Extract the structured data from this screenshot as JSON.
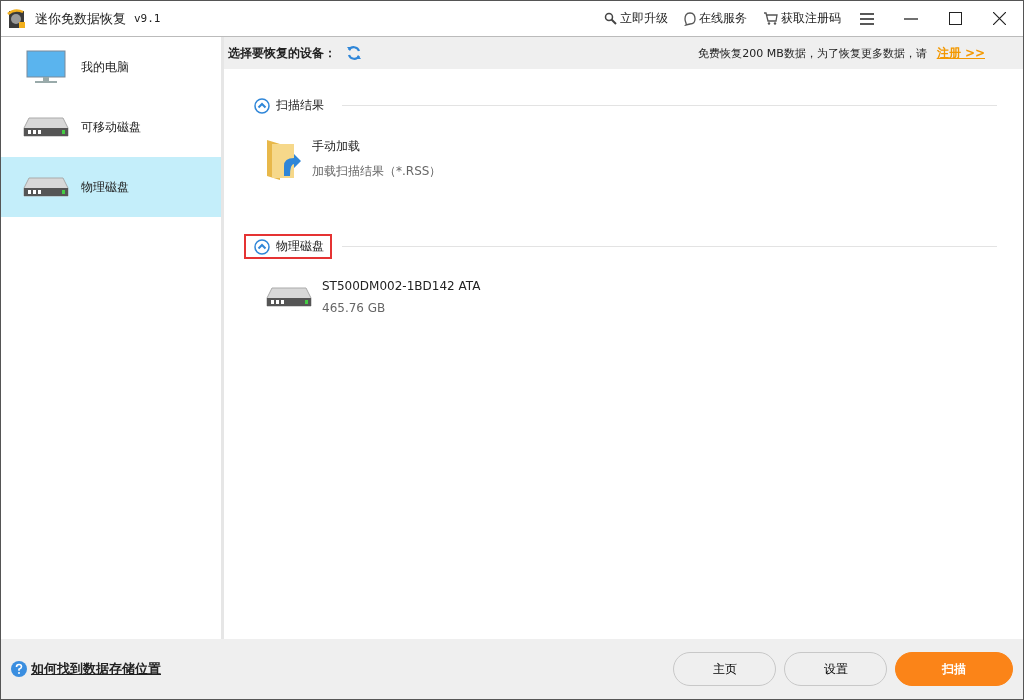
{
  "window": {
    "title": "迷你免数据恢复",
    "version": "v9.1"
  },
  "title_links": [
    {
      "kind": "upgrade",
      "label": "立即升级"
    },
    {
      "kind": "service",
      "label": "在线服务"
    },
    {
      "kind": "register",
      "label": "获取注册码"
    }
  ],
  "sidebar": {
    "items": [
      {
        "kind": "computer",
        "label": "我的电脑",
        "selected": false
      },
      {
        "kind": "removable",
        "label": "可移动磁盘",
        "selected": false
      },
      {
        "kind": "physical",
        "label": "物理磁盘",
        "selected": true
      }
    ]
  },
  "toolbar": {
    "label": "选择要恢复的设备：",
    "notice": "免费恢复200 MB数据，为了恢复更多数据，请",
    "register_link": "注册 >>"
  },
  "sections": [
    {
      "title": "扫描结果",
      "expanded": true,
      "highlighted": false,
      "items": [
        {
          "kind": "folder",
          "name": "手动加载",
          "detail": "加载扫描结果（*.RSS）"
        }
      ]
    },
    {
      "title": "物理磁盘",
      "expanded": true,
      "highlighted": true,
      "items": [
        {
          "kind": "disk",
          "name": "ST500DM002-1BD142 ATA",
          "detail": "465.76 GB"
        }
      ]
    }
  ],
  "footer": {
    "help_link": "如何找到数据存储位置",
    "buttons": [
      {
        "label": "主页",
        "primary": false
      },
      {
        "label": "设置",
        "primary": false
      },
      {
        "label": "扫描",
        "primary": true
      }
    ]
  }
}
